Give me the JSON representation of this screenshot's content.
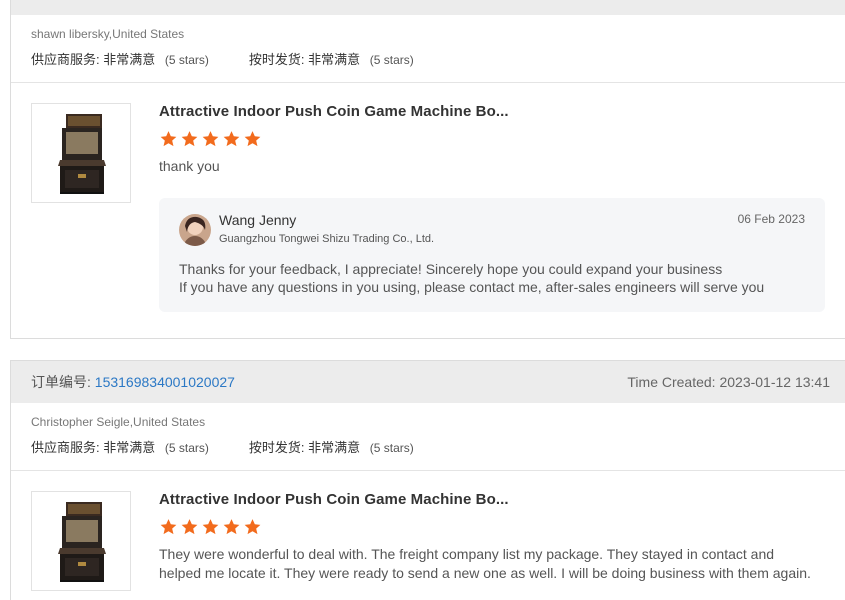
{
  "review1": {
    "buyer": "shawn libersky,United States",
    "ratings": [
      {
        "label": "供应商服务:",
        "value": "非常满意",
        "stars": "(5 stars)"
      },
      {
        "label": "按时发货:",
        "value": "非常满意",
        "stars": "(5 stars)"
      }
    ],
    "product_title": "Attractive Indoor Push Coin Game Machine Bo...",
    "rating_stars": 5,
    "comment": "thank you",
    "reply": {
      "seller_name": "Wang Jenny",
      "company": "Guangzhou Tongwei Shizu Trading Co., Ltd.",
      "date": "06 Feb 2023",
      "line1": "Thanks for your feedback, I appreciate! Sincerely hope you could expand your business",
      "line2": "If you have any questions in you using, please contact me, after-sales engineers will serve you"
    }
  },
  "order2": {
    "order_label": "订单编号:",
    "order_number": "153169834001020027",
    "time_created": "Time Created: 2023-01-12 13:41"
  },
  "review2": {
    "buyer": "Christopher Seigle,United States",
    "ratings": [
      {
        "label": "供应商服务:",
        "value": "非常满意",
        "stars": "(5 stars)"
      },
      {
        "label": "按时发货:",
        "value": "非常满意",
        "stars": "(5 stars)"
      }
    ],
    "product_title": "Attractive Indoor Push Coin Game Machine Bo...",
    "rating_stars": 5,
    "comment": "They were wonderful to deal with. The freight company list my package. They stayed in contact and helped me locate it. They were ready to send a new one as well. I will be doing business with them again."
  },
  "colors": {
    "star": "#f26b1d",
    "link": "#2b78c5",
    "header_bg": "#ececec"
  },
  "icons": {
    "star": "star-icon",
    "product": "coin-machine-image",
    "avatar": "seller-avatar"
  }
}
